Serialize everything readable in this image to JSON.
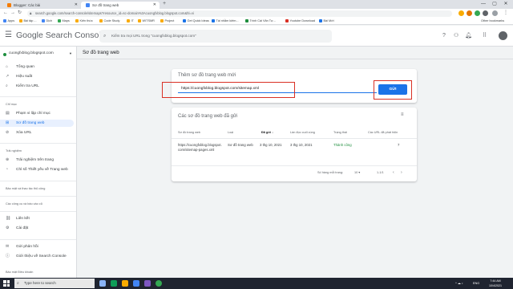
{
  "browser": {
    "tabs": [
      {
        "label": "Blogger: Các bài",
        "active": false
      },
      {
        "label": "Sơ đồ trang web",
        "active": true
      }
    ],
    "url": "search.google.com/search-console/sitemaps?resource_id=sc-domain%3Acuongfxblog.blogspot.com&hl=vi",
    "bookmarks": [
      "Apps",
      "Bài tập ...",
      "Dịch",
      "Maps",
      "Kiến thức",
      "Code Study",
      "IT",
      "WITSMR",
      "Project",
      "Get Quick Ideas",
      "Tài nhằm kiếm...",
      "Trình Cài Văn Tự...",
      "Youtube Download",
      "Bài Mới"
    ],
    "other_bookmarks": "Other bookmarks",
    "new_tab_glyph": "+",
    "window_controls": [
      "—",
      "▢",
      "✕"
    ]
  },
  "header": {
    "brand": "Google Search Console",
    "search_placeholder": "Kiểm tra mọi URL trong \"cuongfxblog.blogspot.com\""
  },
  "sidebar": {
    "property": "cuongfxblog.blogspot.com",
    "items_top": [
      {
        "label": "Tổng quan",
        "icon": "home-icon"
      },
      {
        "label": "Hiệu suất",
        "icon": "trending-icon"
      },
      {
        "label": "Kiểm tra URL",
        "icon": "search-icon"
      }
    ],
    "section_index": "Chỉ mục",
    "items_index": [
      {
        "label": "Phạm vi lập chỉ mục",
        "icon": "coverage-icon",
        "active": false
      },
      {
        "label": "Sơ đồ trang web",
        "icon": "sitemap-icon",
        "active": true
      },
      {
        "label": "Xóa URL",
        "icon": "remove-icon",
        "active": false
      }
    ],
    "section_experience": "Trải nghiệm",
    "items_experience": [
      {
        "label": "Trải nghiệm trên trang",
        "icon": "experience-icon"
      },
      {
        "label": "Chỉ số Thiết yếu về Trang web",
        "icon": "vitals-icon"
      }
    ],
    "section_security": "Bảo mật và thao tác thủ công",
    "section_legacy": "Các công cụ và báo cáo cũ",
    "items_links": [
      {
        "label": "Liên kết",
        "icon": "links-icon"
      },
      {
        "label": "Cài đặt",
        "icon": "settings-icon"
      }
    ],
    "items_footer": [
      {
        "label": "Gửi phản hồi",
        "icon": "feedback-icon"
      },
      {
        "label": "Giới thiệu về Search Console",
        "icon": "info-icon"
      }
    ],
    "footer_links": "Bảo mật   Điều khoản"
  },
  "main": {
    "page_title": "Sơ đồ trang web",
    "add_card": {
      "title": "Thêm sơ đồ trang web mới",
      "input_value": "https://cuongfxblog.blogspot.com/sitemap.xml",
      "submit_label": "GỬI"
    },
    "submitted_card": {
      "title": "Các sơ đồ trang web đã gửi",
      "columns": [
        "Sơ đồ trang web",
        "Loại",
        "Đã gửi ↓",
        "Lần đọc cuối cùng",
        "Trạng thái",
        "Các URL đã phát hiện"
      ],
      "rows": [
        {
          "sitemap": "https://cuongfxblog.blogspot.com/sitemap-pages.xml",
          "type": "Sơ đồ trang web",
          "submitted": "3 thg 10, 2021",
          "last_read": "3 thg 10, 2021",
          "status": "Thành công",
          "discovered": "7"
        }
      ],
      "pager": {
        "rows_label": "Số hàng mỗi trang:",
        "rows_value": "10 ▾",
        "range": "1-1/1",
        "prev": "‹",
        "next": "›"
      }
    }
  },
  "taskbar": {
    "search_placeholder": "Type here to search",
    "tray_lang": "ENG",
    "time": "7:44 AM",
    "date": "10/4/2021"
  },
  "colors": {
    "accent": "#1a73e8",
    "highlight": "#d93025",
    "success": "#1e8e3e"
  }
}
